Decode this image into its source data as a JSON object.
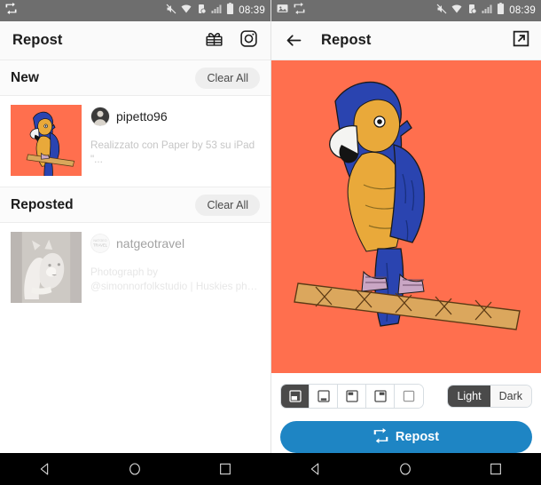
{
  "statusbar": {
    "time": "08:39",
    "icons_left_panel": [
      "repost-icon"
    ],
    "icons_right_panel": [
      "image-icon",
      "repost-icon"
    ],
    "icons_right": [
      "mute-icon",
      "wifi-icon",
      "vibrate-icon",
      "signal-icon",
      "battery-icon"
    ]
  },
  "left_panel": {
    "appbar": {
      "title": "Repost",
      "actions": [
        {
          "name": "gift-icon",
          "label": "Gift"
        },
        {
          "name": "instagram-icon",
          "label": "Instagram"
        }
      ]
    },
    "sections": [
      {
        "title": "New",
        "clear_label": "Clear All",
        "faded": false,
        "post": {
          "username": "pipetto96",
          "caption": "Realizzato con Paper by 53 su iPad\n\"...",
          "avatar_kind": "photo-avatar",
          "thumb_kind": "parrot-thumb"
        }
      },
      {
        "title": "Reposted",
        "clear_label": "Clear All",
        "faded": true,
        "post": {
          "username": "natgeotravel",
          "caption": "Photograph by\n@simonnorfolkstudio | Huskies ph…",
          "avatar_kind": "natgeo-avatar",
          "thumb_kind": "husky-thumb"
        }
      }
    ]
  },
  "right_panel": {
    "appbar": {
      "back_icon": "back-arrow-icon",
      "title": "Repost",
      "share_icon": "external-link-icon"
    },
    "preview": {
      "background_color": "#ff6f4e",
      "image_description": "blue-and-gold-macaw-on-perch"
    },
    "watermark_positions": [
      {
        "name": "position-bottom-left",
        "selected": true
      },
      {
        "name": "position-bottom-center",
        "selected": false
      },
      {
        "name": "position-top-left",
        "selected": false
      },
      {
        "name": "position-top-right",
        "selected": false
      },
      {
        "name": "position-none",
        "selected": false
      }
    ],
    "theme_toggle": {
      "light_label": "Light",
      "dark_label": "Dark",
      "selected": "Light"
    },
    "repost_button": {
      "label": "Repost",
      "color": "#1e85c4"
    }
  },
  "navbar": {
    "buttons": [
      "back-nav-icon",
      "home-nav-icon",
      "recents-nav-icon"
    ]
  }
}
